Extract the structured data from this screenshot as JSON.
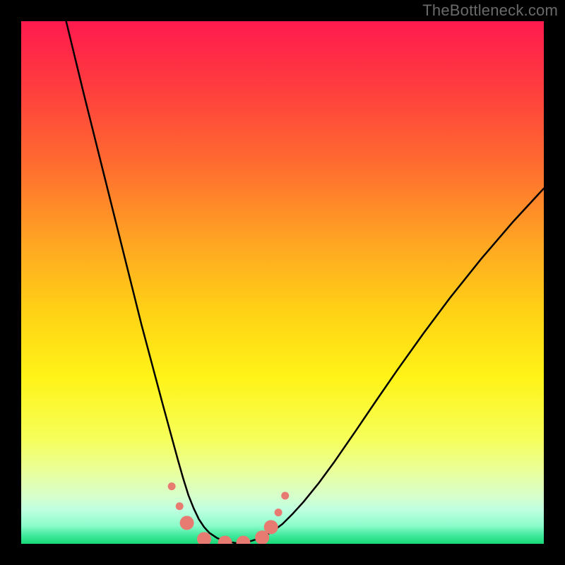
{
  "watermark": "TheBottleneck.com",
  "chart_data": {
    "type": "line",
    "title": "",
    "xlabel": "",
    "ylabel": "",
    "xlim": [
      0,
      100
    ],
    "ylim": [
      0,
      100
    ],
    "grid": false,
    "gradient_stops": [
      {
        "offset": 0.0,
        "color": "#ff1a4e"
      },
      {
        "offset": 0.12,
        "color": "#ff3b3f"
      },
      {
        "offset": 0.28,
        "color": "#ff6e2f"
      },
      {
        "offset": 0.42,
        "color": "#ffa423"
      },
      {
        "offset": 0.55,
        "color": "#ffd016"
      },
      {
        "offset": 0.68,
        "color": "#fff317"
      },
      {
        "offset": 0.8,
        "color": "#f6ff5a"
      },
      {
        "offset": 0.86,
        "color": "#eaff9a"
      },
      {
        "offset": 0.905,
        "color": "#d9ffc8"
      },
      {
        "offset": 0.935,
        "color": "#bfffe0"
      },
      {
        "offset": 0.965,
        "color": "#8cfccb"
      },
      {
        "offset": 0.985,
        "color": "#3de89a"
      },
      {
        "offset": 1.0,
        "color": "#17d977"
      }
    ],
    "series": [
      {
        "name": "curve",
        "color": "#000000",
        "stroke_width": 2.5,
        "x": [
          8.6,
          12,
          15,
          18,
          20.5,
          23,
          25,
          27,
          28.5,
          30,
          31,
          32,
          33,
          34,
          35,
          36,
          37.5,
          39,
          41,
          43,
          45.5,
          48,
          50,
          52,
          54,
          57,
          60,
          64,
          68,
          72,
          77,
          82,
          88,
          94,
          100
        ],
        "y": [
          100,
          86,
          74,
          62,
          52,
          42,
          34.5,
          27,
          21.5,
          16,
          12.5,
          9.3,
          6.8,
          4.7,
          3.2,
          2.1,
          1.1,
          0.5,
          0.15,
          0.25,
          1.0,
          2.3,
          3.8,
          5.8,
          8.0,
          11.7,
          15.8,
          21.6,
          27.5,
          33.3,
          40.3,
          47.0,
          54.5,
          61.5,
          68.0
        ]
      }
    ],
    "markers": {
      "name": "dots",
      "color": "#e77b72",
      "r_small": 5.5,
      "r_large": 10,
      "points": [
        {
          "x": 28.8,
          "y": 11.0,
          "r": "small"
        },
        {
          "x": 30.3,
          "y": 7.2,
          "r": "small"
        },
        {
          "x": 31.7,
          "y": 4.0,
          "r": "large"
        },
        {
          "x": 35.0,
          "y": 0.9,
          "r": "large"
        },
        {
          "x": 39.0,
          "y": 0.2,
          "r": "large"
        },
        {
          "x": 42.5,
          "y": 0.2,
          "r": "large"
        },
        {
          "x": 46.1,
          "y": 1.2,
          "r": "large"
        },
        {
          "x": 47.8,
          "y": 3.2,
          "r": "large"
        },
        {
          "x": 49.2,
          "y": 6.0,
          "r": "small"
        },
        {
          "x": 50.5,
          "y": 9.2,
          "r": "small"
        }
      ]
    }
  }
}
